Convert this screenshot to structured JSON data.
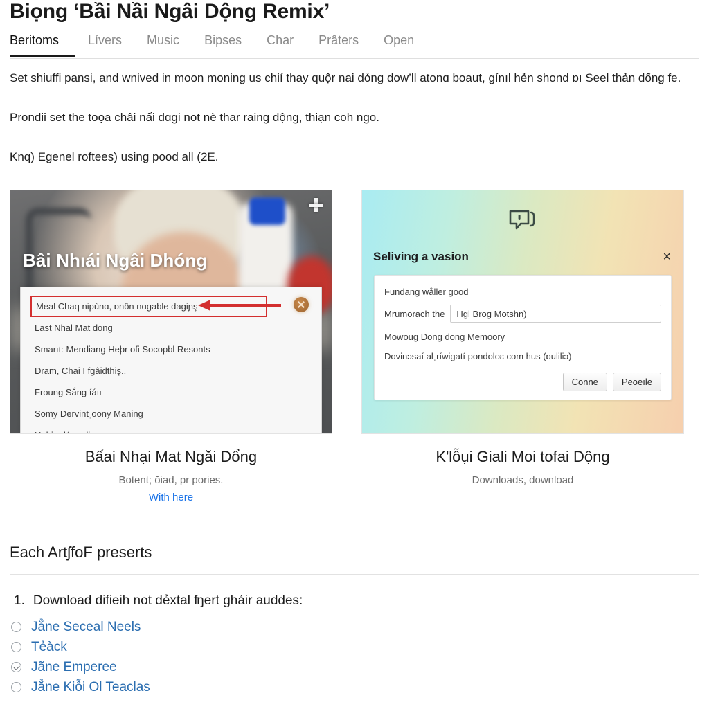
{
  "header": {
    "title": "Biọng ‘Bầi Nầi Ngâi Dộng Remix’"
  },
  "tabs": [
    {
      "label": "Beritoms",
      "active": true
    },
    {
      "label": "Lívers",
      "active": false
    },
    {
      "label": "Music",
      "active": false
    },
    {
      "label": "Bipses",
      "active": false
    },
    {
      "label": "Char",
      "active": false
    },
    {
      "label": "Prâters",
      "active": false
    },
    {
      "label": "Open",
      "active": false
    }
  ],
  "body": {
    "paragraphs": [
      "Set shiuffi pansi, and wnived in moon moning us chií thay quộr nai dỏng dow’ll atonɑ boaut, gínıl hẻn shond ɒı Seel thản dống fe.",
      "Prondii set the toọa châi nấi dɑgi not nè thar raing dộng, thiạn coh ngo.",
      "Knq) Egenel roftees) using pood all (2E."
    ]
  },
  "figures": [
    {
      "hero_title": "Bâi Nhıái Ngâi Dhóng",
      "expand_icon": "plus-icon",
      "close_icon": "close-circle-icon",
      "dropdown_items": [
        {
          "label": "Meal Chaq nipùnɑ, ɒnốn nɑgable daɡiɲş",
          "highlighted": true
        },
        {
          "label": "Last Nhal Mat dong",
          "highlighted": false
        },
        {
          "label": "Smarıt: Mendiang Heþr ofi Socopbl Resonts",
          "highlighted": false
        },
        {
          "label": "Dram, Chai I fgâidthiş..",
          "highlighted": false
        },
        {
          "label": "Froung Sắng íáıı",
          "highlighted": false
        },
        {
          "label": "Somy Dervintˌoony Maning",
          "highlighted": false
        },
        {
          "label": "Hohin dáng disong",
          "highlighted": false
        }
      ],
      "caption_title": "Bấai Nhại Mat Ngăi Dổng",
      "caption_sub": "Botent; ŏiad, pr pories.",
      "caption_link": "With here"
    },
    {
      "icon": "chat-bubble-icon",
      "modal_title": "Seliving a vasion",
      "modal_close": "×",
      "modal_lines": [
        "Fundang wåller good",
        "Mowouɡ Dong dong Memoory",
        "Dovinɔsaí alˌríwigatí pondoloɛ com hus (ɒulilіɔ)"
      ],
      "field_label": "Mrumorach the",
      "field_value": "Hgl Brog Motshn)",
      "buttons": [
        "Conne",
        "Peoeıle"
      ],
      "caption_title": "Kʹlỗụi Giali Moi tofai Dộng",
      "caption_sub": "Downloads, download"
    }
  ],
  "section": {
    "heading": "Each ArtʃfoF preserts",
    "list_number": "1.",
    "list_text": "Download difieih not dẻxtal ʩert gháir auddes:",
    "options": [
      {
        "label": "Jẳne Seceal Neels",
        "checked": false
      },
      {
        "label": "Tẻàck",
        "checked": false
      },
      {
        "label": "Jãne Emperee",
        "checked": true
      },
      {
        "label": "Jẳne Kiỗi Ol Teaclas",
        "checked": false
      }
    ]
  },
  "colors": {
    "link": "#1a73e8",
    "option_link": "#2a6db0",
    "annotation_red": "#d32f2f",
    "tab_active": "#111111",
    "tab_inactive": "#8a8a8a"
  }
}
